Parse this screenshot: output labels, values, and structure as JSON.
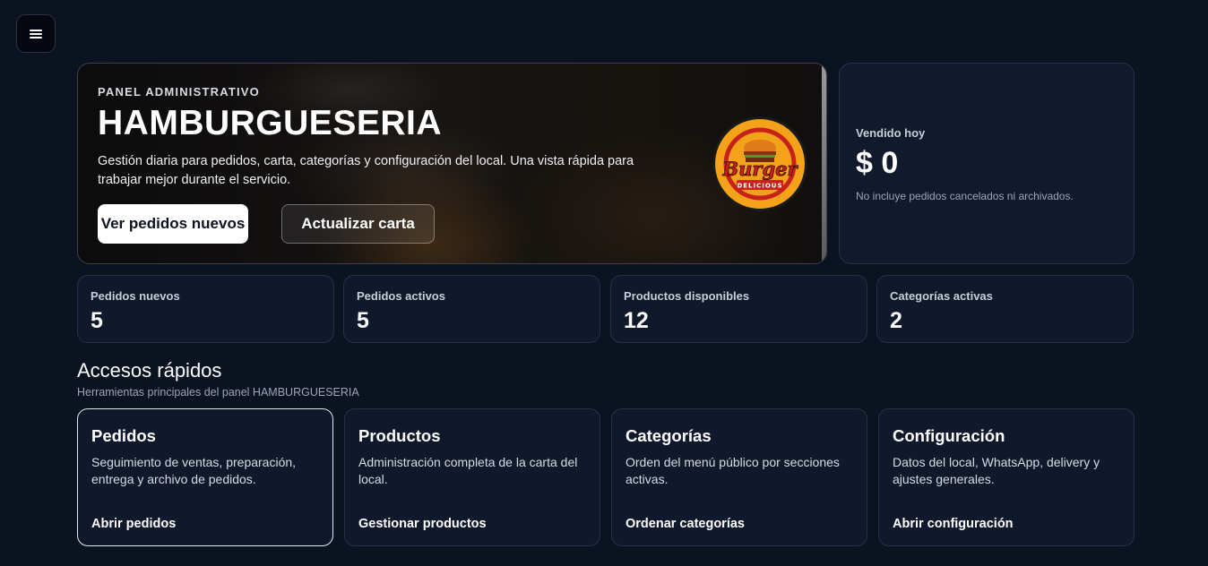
{
  "menu": {
    "icon": "hamburger-menu-icon"
  },
  "hero": {
    "kicker": "PANEL ADMINISTRATIVO",
    "title": "HAMBURGUESERIA",
    "description": "Gestión diaria para pedidos, carta, categorías y configuración del local. Una vista rápida para trabajar mejor durante el servicio.",
    "primary_button": "Ver pedidos nuevos",
    "secondary_button": "Actualizar carta",
    "logo": {
      "text_main": "Burger",
      "text_sub": "DELICIOUS"
    }
  },
  "sales": {
    "label": "Vendido hoy",
    "value": "$ 0",
    "note": "No incluye pedidos cancelados ni archivados."
  },
  "stats": [
    {
      "label": "Pedidos nuevos",
      "value": "5"
    },
    {
      "label": "Pedidos activos",
      "value": "5"
    },
    {
      "label": "Productos disponibles",
      "value": "12"
    },
    {
      "label": "Categorías activas",
      "value": "2"
    }
  ],
  "quick_access": {
    "title": "Accesos rápidos",
    "subtitle": "Herramientas principales del panel HAMBURGUESERIA",
    "cards": [
      {
        "title": "Pedidos",
        "description": "Seguimiento de ventas, preparación, entrega y archivo de pedidos.",
        "link": "Abrir pedidos"
      },
      {
        "title": "Productos",
        "description": "Administración completa de la carta del local.",
        "link": "Gestionar productos"
      },
      {
        "title": "Categorías",
        "description": "Orden del menú público por secciones activas.",
        "link": "Ordenar categorías"
      },
      {
        "title": "Configuración",
        "description": "Datos del local, WhatsApp, delivery y ajustes generales.",
        "link": "Abrir configuración"
      }
    ]
  },
  "colors": {
    "background": "#0b1220",
    "card": "#0f192b",
    "card_border": "#263048",
    "logo_orange": "#f3a21a",
    "logo_red": "#c8211b"
  }
}
